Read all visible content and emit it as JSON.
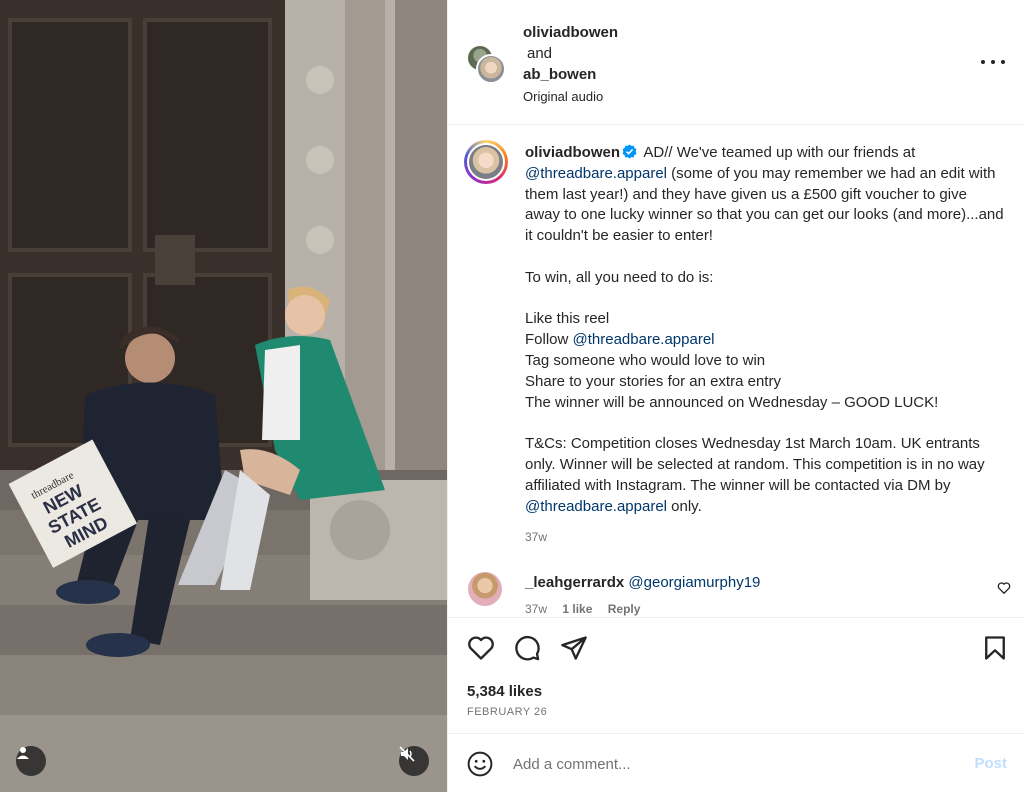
{
  "header": {
    "user1": "oliviadbowen",
    "and_text": "and",
    "user2": "ab_bowen",
    "audio": "Original audio"
  },
  "media": {
    "newspaper_brand": "threadbare",
    "newspaper_headline_1": "NEW",
    "newspaper_headline_2": "STATE",
    "newspaper_headline_3": "MIND"
  },
  "caption": {
    "username": "oliviadbowen",
    "line1": "AD// We've teamed up with our friends at",
    "mention1": "@threadbare.apparel",
    "line2_rest": " (some of you may remember we had an edit with them last year!) and they have given us a £500 gift voucher to give away to one lucky winner so that you can get our looks (and more)...and it couldn't be easier to enter!",
    "p2": "To win, all you need to do is:",
    "step1": "Like this reel",
    "step2_prefix": "Follow ",
    "step2_mention": "@threadbare.apparel",
    "step3": "Tag someone who would love to win",
    "step4": "Share to your stories for an extra entry",
    "step5": "The winner will be announced on Wednesday – GOOD LUCK!",
    "tc_text": "T&Cs: Competition closes Wednesday 1st March 10am. UK entrants only. Winner will be selected at random. This competition is in no way affiliated with Instagram. The winner will be contacted via DM by ",
    "tc_mention": "@threadbare.apparel",
    "tc_end": " only.",
    "time": "37w"
  },
  "comment": {
    "username": "_leahgerrardx",
    "mention": "@georgiamurphy19",
    "time": "37w",
    "likes": "1 like",
    "reply": "Reply"
  },
  "actions": {
    "likes": "5,384 likes",
    "date": "FEBRUARY 26"
  },
  "add_comment": {
    "placeholder": "Add a comment...",
    "post_label": "Post"
  }
}
